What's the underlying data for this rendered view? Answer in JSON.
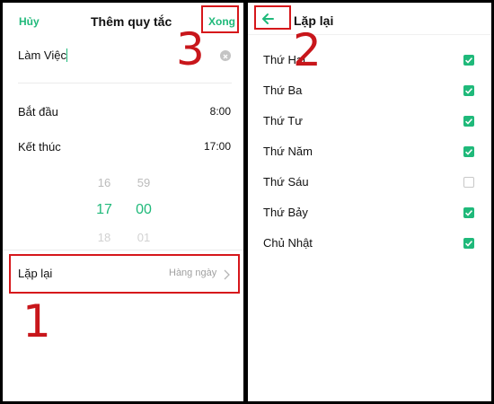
{
  "left": {
    "header": {
      "cancel_label": "Hủy",
      "title": "Thêm quy tắc",
      "done_label": "Xong"
    },
    "name_input": {
      "value": "Làm Việc"
    },
    "start": {
      "label": "Bắt đầu",
      "value": "8:00"
    },
    "end": {
      "label": "Kết thúc",
      "value": "17:00"
    },
    "picker": {
      "hours": [
        "16",
        "17",
        "18"
      ],
      "minutes": [
        "59",
        "00",
        "01"
      ]
    },
    "repeat": {
      "label": "Lặp lại",
      "value": "Hàng ngày"
    }
  },
  "right": {
    "header": {
      "title": "Lặp lại"
    },
    "days": [
      {
        "label": "Thứ Hai",
        "checked": true
      },
      {
        "label": "Thứ Ba",
        "checked": true
      },
      {
        "label": "Thứ Tư",
        "checked": true
      },
      {
        "label": "Thứ Năm",
        "checked": true
      },
      {
        "label": "Thứ Sáu",
        "checked": false
      },
      {
        "label": "Thứ Bảy",
        "checked": true
      },
      {
        "label": "Chủ Nhật",
        "checked": true
      }
    ]
  },
  "annotations": {
    "step1": "1",
    "step2": "2",
    "step3": "3"
  },
  "colors": {
    "accent": "#1fb97a",
    "annotation": "#c8161b"
  }
}
